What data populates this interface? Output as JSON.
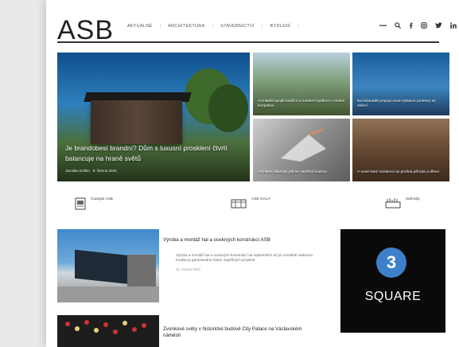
{
  "logo": "ASB",
  "nav": [
    "AKTUÁLNĚ",
    "ARCHITEKTURA",
    "STAVEBNICTVÍ",
    "BYDLENÍ"
  ],
  "hero": {
    "title": "Je brandobesí  brandní? Dům s luxusní prosklení čtvrtí balancuje na hraně světů",
    "meta": "Jaroslav Doško · 8. června 2023"
  },
  "tiles": [
    {
      "caption": "Architekti spojili tradiční a moderní bydlení v novém komplexu"
    },
    {
      "caption": "Na kolonádě propojí nové výstavní prostory se zelení"
    },
    {
      "caption": "Architekt ukazuje, jak se navrhují budovy"
    },
    {
      "caption": "V nové lesní rezidenci se prolíná příroda a dřevo"
    }
  ],
  "categories": [
    {
      "label": "Časopis ASB"
    },
    {
      "label": "ASB GALA"
    },
    {
      "label": "Zahrady"
    }
  ],
  "articles": [
    {
      "title": "Výroba a montáž hal a ocelových konstrukcí ASB",
      "excerpt": "Výroba a montáž hal a ocelových konstrukcí od nejmenších až po rozsáhlé realizace. Kvalita je garantována řadou úspěšných projektů.",
      "date": "15. června 2023"
    },
    {
      "title": "Zvonkové světy v historické budově City Palace na Václavském náměstí"
    }
  ],
  "ad": {
    "number": "3",
    "word": "SQUARE"
  },
  "colors": {
    "ad_badge": "#3d80c9",
    "rule": "#333333"
  }
}
